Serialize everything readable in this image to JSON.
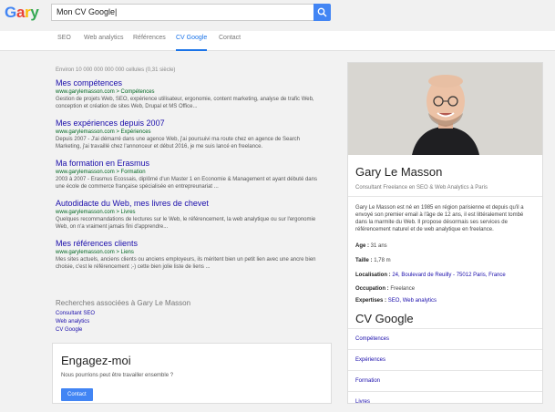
{
  "logo": {
    "letters": [
      "G",
      "a",
      "r",
      "y"
    ],
    "colors": [
      "#4285f4",
      "#ea4335",
      "#fbbc05",
      "#34a853"
    ]
  },
  "search": {
    "value": "Mon CV Google|"
  },
  "nav": {
    "tabs": [
      "SEO",
      "Web analytics",
      "Références",
      "CV Google",
      "Contact"
    ],
    "active": "CV Google"
  },
  "results": {
    "stats": "Environ 10 000 000 000 000 cellules (0,31 siècle)",
    "items": [
      {
        "title": "Mes compétences",
        "url": "www.garylemasson.com > Compétences",
        "snippet": [
          "Gestion de projets Web, SEO, expérience utilisateur, ergonomie, content marketing, analyse de trafic Web,",
          "conception et création de sites Web, Drupal et MS Office..."
        ]
      },
      {
        "title": "Mes expériences depuis 2007",
        "url": "www.garylemasson.com > Expériences",
        "snippet": [
          "Depuis 2007 - J'ai démarré dans une agence Web, j'ai poursuivi ma route chez en agence de Search",
          "Marketing, j'ai travaillé chez l'annonceur et début 2016, je me suis lancé en freelance."
        ]
      },
      {
        "title": "Ma formation en Erasmus",
        "url": "www.garylemasson.com > Formation",
        "snippet": [
          "2003 à 2007 - Erasmus Ecossais, diplômé d'un Master 1 en Economie & Management et ayant débuté dans",
          "une école de commerce française spécialisée en entrepreunariat ..."
        ]
      },
      {
        "title": "Autodidacte du Web, mes livres de chevet",
        "url": "www.garylemasson.com > Livres",
        "snippet": [
          "Quelques recommandations de lectures sur le Web, le référencement, la web analytique ou sur l'ergonomie",
          "Web, on n'a vraiment jamais fini d'apprendre..."
        ]
      },
      {
        "title": "Mes références clients",
        "url": "www.garylemasson.com > Liens",
        "snippet": [
          "Mes sites actuels, anciens clients ou anciens employeurs, ils méritent bien un petit lien avec une ancre bien",
          "choisie, c'est le référencement ;-) cette bien jolie liste de liens ..."
        ]
      }
    ]
  },
  "related": {
    "title": "Recherches associées à Gary Le Masson",
    "links": [
      "Consultant SEO",
      "Web analytics",
      "CV Google"
    ]
  },
  "card": {
    "title": "Engagez-moi",
    "text": "Nous pourrions peut être travailler ensemble ?",
    "button": "Contact"
  },
  "knowledge": {
    "name": "Gary Le Masson",
    "subtitle": "Consultant Freelance en SEO & Web Analytics à Paris",
    "description": [
      "Gary Le Masson est né en 1985 en région parisienne et depuis qu'il a",
      "envoyé son premier email à l'âge de 12 ans, il est littéralement tombé",
      "dans la marmite du Web. Il propose désormais ses services de",
      "référencement naturel et de web analytique en freelance."
    ],
    "facts": [
      {
        "label": "Age :",
        "value": "31 ans",
        "link": false
      },
      {
        "label": "Taille :",
        "value": "1,78 m",
        "link": false
      },
      {
        "label": "Localisation :",
        "value": "24, Boulevard de Reuilly - 75012 Paris, France",
        "link": true
      },
      {
        "label": "Occupation :",
        "value": "Freelance",
        "link": false
      },
      {
        "label": "Expertises :",
        "value": "SEO, Web analytics",
        "link": true
      }
    ],
    "section_title": "CV Google",
    "links": [
      "Compétences",
      "Expériences",
      "Formation",
      "Livres"
    ]
  }
}
